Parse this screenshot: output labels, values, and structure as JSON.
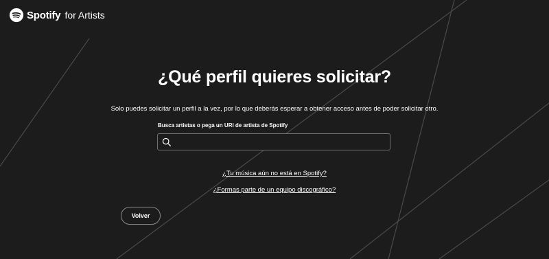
{
  "header": {
    "brand": "Spotify",
    "brand_suffix": "for Artists",
    "logo_icon": "spotify-logo-icon"
  },
  "main": {
    "title": "¿Qué perfil quieres solicitar?",
    "subtitle": "Solo puedes solicitar un perfil a la vez, por lo que deberás esperar a obtener acceso antes de poder solicitar otro.",
    "search": {
      "label": "Busca artistas o pega un URI de artista de Spotify",
      "value": "",
      "icon": "search-icon"
    },
    "links": {
      "not_on_spotify": "¿Tu música aún no está en Spotify?",
      "label_team": "¿Formas parte de un equipo discográfico?"
    },
    "back_button": "Volver"
  },
  "colors": {
    "background": "#1c1c1c",
    "text": "#ffffff",
    "border": "#6f6f6f",
    "decor_lines": "#4a4a4a"
  }
}
